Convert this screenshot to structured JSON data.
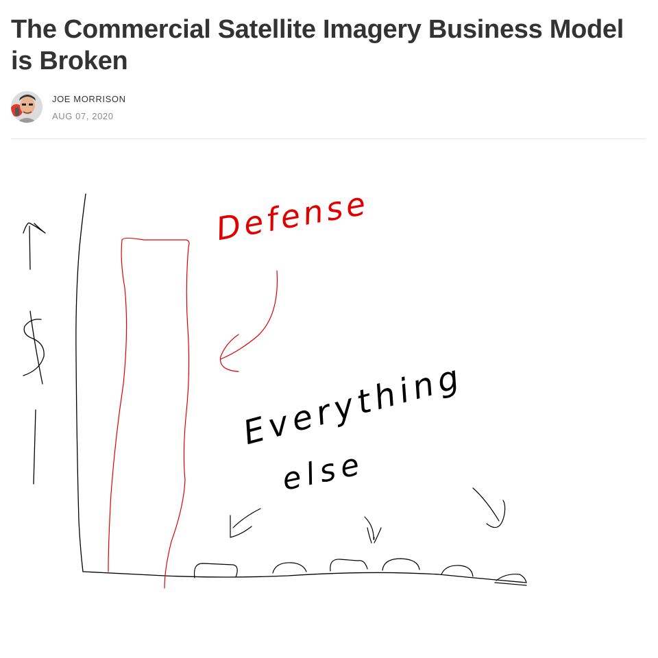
{
  "article": {
    "title": "The Commercial Satellite Imagery Business Model is Broken",
    "author": "JOE MORRISON",
    "date": "AUG 07, 2020"
  },
  "sketch": {
    "y_axis_symbol": "$",
    "labels": {
      "defense": "Defense",
      "everything": "Everything",
      "else": "else"
    }
  },
  "colors": {
    "text": "#333333",
    "muted": "#8a8a8a",
    "rule": "#e5e5e5",
    "ink_black": "#000000",
    "ink_red": "#e00000"
  }
}
